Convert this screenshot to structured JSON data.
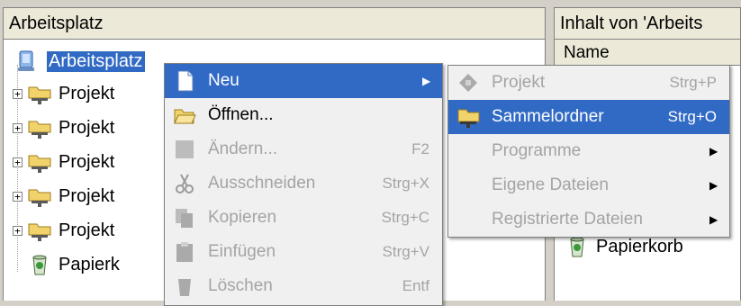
{
  "left_pane": {
    "title": "Arbeitsplatz",
    "tree": [
      {
        "label": "Arbeitsplatz",
        "icon": "computer-icon",
        "selected": true
      },
      {
        "label": "Projekt",
        "icon": "network-folder-icon"
      },
      {
        "label": "Projekt",
        "icon": "network-folder-icon"
      },
      {
        "label": "Projekt",
        "icon": "network-folder-icon"
      },
      {
        "label": "Projekt",
        "icon": "network-folder-icon"
      },
      {
        "label": "Projekt",
        "icon": "network-folder-icon"
      },
      {
        "label": "Papierk",
        "icon": "recycle-bin-icon"
      }
    ]
  },
  "right_pane": {
    "title": "Inhalt von 'Arbeits",
    "column_name": "Name",
    "partial_item": "Papierkorb"
  },
  "context_menu": [
    {
      "label": "Neu",
      "icon": "new-document-icon",
      "accel": "",
      "submenu": true,
      "state": "hover"
    },
    {
      "label": "Öffnen...",
      "icon": "open-folder-icon",
      "accel": "",
      "state": "enabled"
    },
    {
      "label": "Ändern...",
      "icon": "edit-icon",
      "accel": "F2",
      "state": "disabled"
    },
    {
      "label": "Ausschneiden",
      "icon": "scissors-icon",
      "accel": "Strg+X",
      "state": "disabled"
    },
    {
      "label": "Kopieren",
      "icon": "copy-icon",
      "accel": "Strg+C",
      "state": "disabled"
    },
    {
      "label": "Einfügen",
      "icon": "paste-icon",
      "accel": "Strg+V",
      "state": "disabled"
    },
    {
      "label": "Löschen",
      "icon": "delete-icon",
      "accel": "Entf",
      "state": "disabled"
    }
  ],
  "submenu": [
    {
      "label": "Projekt",
      "icon": "project-icon",
      "accel": "Strg+P",
      "state": "disabled"
    },
    {
      "label": "Sammelordner",
      "icon": "network-folder-icon",
      "accel": "Strg+O",
      "state": "hover"
    },
    {
      "label": "Programme",
      "icon": "",
      "accel": "",
      "submenu": true,
      "state": "disabled"
    },
    {
      "label": "Eigene Dateien",
      "icon": "",
      "accel": "",
      "submenu": true,
      "state": "disabled"
    },
    {
      "label": "Registrierte Dateien",
      "icon": "",
      "accel": "",
      "submenu": true,
      "state": "disabled"
    }
  ],
  "colors": {
    "selection": "#316ac5",
    "disabled_text": "#a4a4a4",
    "menu_bg": "#f0f0f0",
    "pane_title_bg": "#ece9d8"
  }
}
